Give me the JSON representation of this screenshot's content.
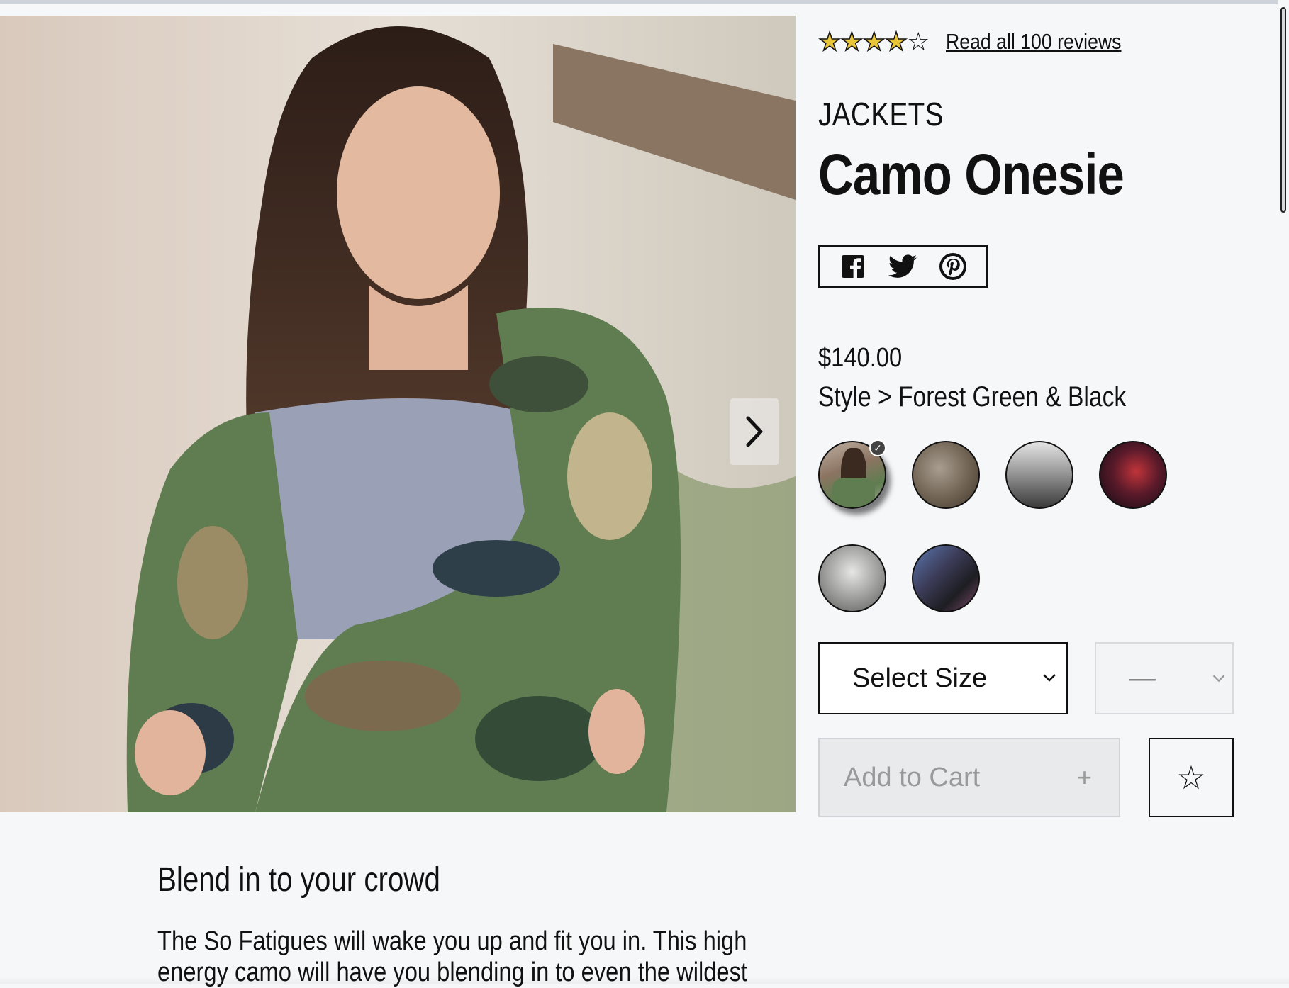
{
  "gallery": {
    "thumbnails": [
      {
        "label": "thumb-1",
        "selected": true
      },
      {
        "label": "thumb-2",
        "selected": false
      },
      {
        "label": "thumb-3",
        "selected": false
      },
      {
        "label": "thumb-4",
        "selected": false
      },
      {
        "label": "thumb-5",
        "selected": false
      },
      {
        "label": "thumb-6",
        "selected": false
      }
    ],
    "next_icon": "chevron-right-icon"
  },
  "rating": {
    "stars_filled": 4,
    "stars_total": 5,
    "reviews_link": "Read all 100 reviews"
  },
  "product": {
    "category": "JACKETS",
    "name": "Camo Onesie",
    "price": "$140.00",
    "style_prefix": "Style > ",
    "style_name": "Forest Green & Black"
  },
  "share": {
    "icons": [
      "facebook-icon",
      "twitter-icon",
      "pinterest-icon"
    ]
  },
  "styles": {
    "swatch_count": 6,
    "selected_index": 0
  },
  "controls": {
    "size_select": "Select Size",
    "quantity_select": "—",
    "add_to_cart": "Add to Cart",
    "add_to_cart_plus": "+",
    "favorite_star": "☆"
  },
  "description": {
    "heading": "Blend in to your crowd",
    "body": "The So Fatigues will wake you up and fit you in. This high energy camo will have you blending in to even the wildest"
  },
  "colors": {
    "background": "#f6f7f9",
    "text": "#111111",
    "disabled": "#e9eaec"
  }
}
